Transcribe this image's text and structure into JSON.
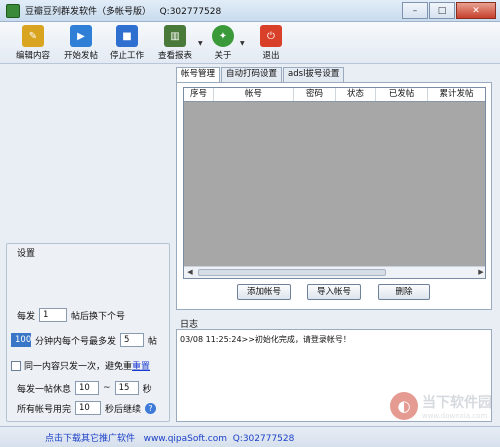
{
  "window": {
    "title": "豆瓣豆列群发软件（多帐号版）   Q:302777528",
    "minimize_glyph": "–",
    "maximize_glyph": "□",
    "close_glyph": "✕"
  },
  "toolbar": {
    "items": [
      {
        "label": "编辑内容",
        "icon": "edit-icon",
        "color": "#d9a520"
      },
      {
        "label": "开始发帖",
        "icon": "play-icon",
        "color": "#2f7fd6"
      },
      {
        "label": "停止工作",
        "icon": "stop-icon",
        "color": "#2f6fd0"
      },
      {
        "label": "查看报表",
        "icon": "report-icon",
        "color": "#4a7a3a"
      },
      {
        "label": "关于",
        "icon": "about-icon",
        "color": "#3a9a3a"
      },
      {
        "label": "退出",
        "icon": "exit-icon",
        "color": "#d9402a"
      }
    ]
  },
  "tabs": [
    "帐号管理",
    "自动打码设置",
    "adsl拔号设置"
  ],
  "grid": {
    "columns": [
      "序号",
      "帐号",
      "密码",
      "状态",
      "已发帖",
      "累计发帖"
    ]
  },
  "buttons": {
    "add": "添加帐号",
    "import": "导入帐号",
    "delete": "删除"
  },
  "settings": {
    "title": "设置",
    "row1_prefix": "每发",
    "row1_value": "1",
    "row1_suffix": "帖后换下个号",
    "row2_value": "100",
    "row2_mid": "分钟内每个号最多发",
    "row2_value2": "5",
    "row2_suffix": "帖",
    "row3_text": "同一内容只发一次，避免重",
    "row3_link": "重置",
    "row4_prefix": "每发一帖休息",
    "row4_value1": "10",
    "row4_sep": "~",
    "row4_value2": "15",
    "row4_suffix": "秒",
    "row5_prefix": "所有帐号用完",
    "row5_value": "10",
    "row5_suffix": "秒后继续",
    "help_glyph": "?"
  },
  "log": {
    "label": "日志",
    "lines": [
      "03/08 11:25:24>>初始化完成，请登录帐号！"
    ]
  },
  "status": {
    "text": "点击下载其它推广软件   www.qipaSoft.com  Q:302777528"
  },
  "watermark": {
    "main": "当下软件园",
    "sub": "www.downxia.com"
  }
}
